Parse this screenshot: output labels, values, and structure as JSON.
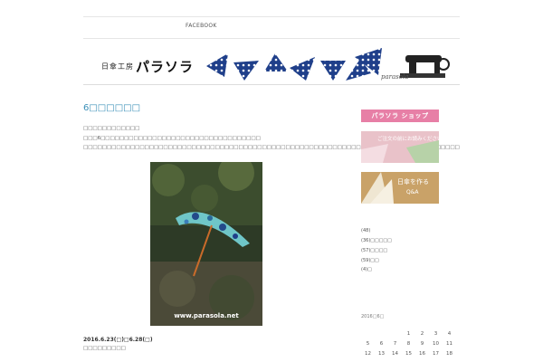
{
  "nav": {
    "facebook": "FACEBOOK"
  },
  "header": {
    "logo_small": "日傘工房",
    "logo_big": "パラソラ",
    "script": "parasola"
  },
  "colors": {
    "navy": "#1f3f8a",
    "title_blue": "#3a8fb7",
    "shop_pink": "#e77fa6"
  },
  "post": {
    "title": "6□□□□□□",
    "line1": "□□□□□□□□□□□□",
    "line2": "□□□6□□□□□□□□□□□□□□□□□□□□□□□□□□□□□□□□□□",
    "line3": "□□□□□□□□□□□□□□□□□□□□□□□□□□□□□□□□□□□□□□□□□□□□□□□□□□□□□□□□□□□□□□□□□□□□□□□□□□□□□□□□□□□□□□□□□□□□□□□□□□",
    "photo_watermark": "www.parasola.net",
    "date": "2016.6.23(□)□6.28(□)",
    "line4": "□□□□□□□□□"
  },
  "sidebar": {
    "shop_button": "パラソラ ショップ",
    "read_button": "ご注文の前にお読みください",
    "make_button_title": "日傘を作る",
    "make_button_sub": "Q&A",
    "categories": [
      "(48)",
      "(36)□□□□□",
      "(57)□□□□",
      "(59)□□",
      "(4)□"
    ],
    "calendar_title": "2016□6□",
    "calendar_rows": [
      [
        "",
        "",
        "",
        "1",
        "2",
        "3",
        "4"
      ],
      [
        "5",
        "6",
        "7",
        "8",
        "9",
        "10",
        "11"
      ],
      [
        "12",
        "13",
        "14",
        "15",
        "16",
        "17",
        "18"
      ]
    ]
  }
}
